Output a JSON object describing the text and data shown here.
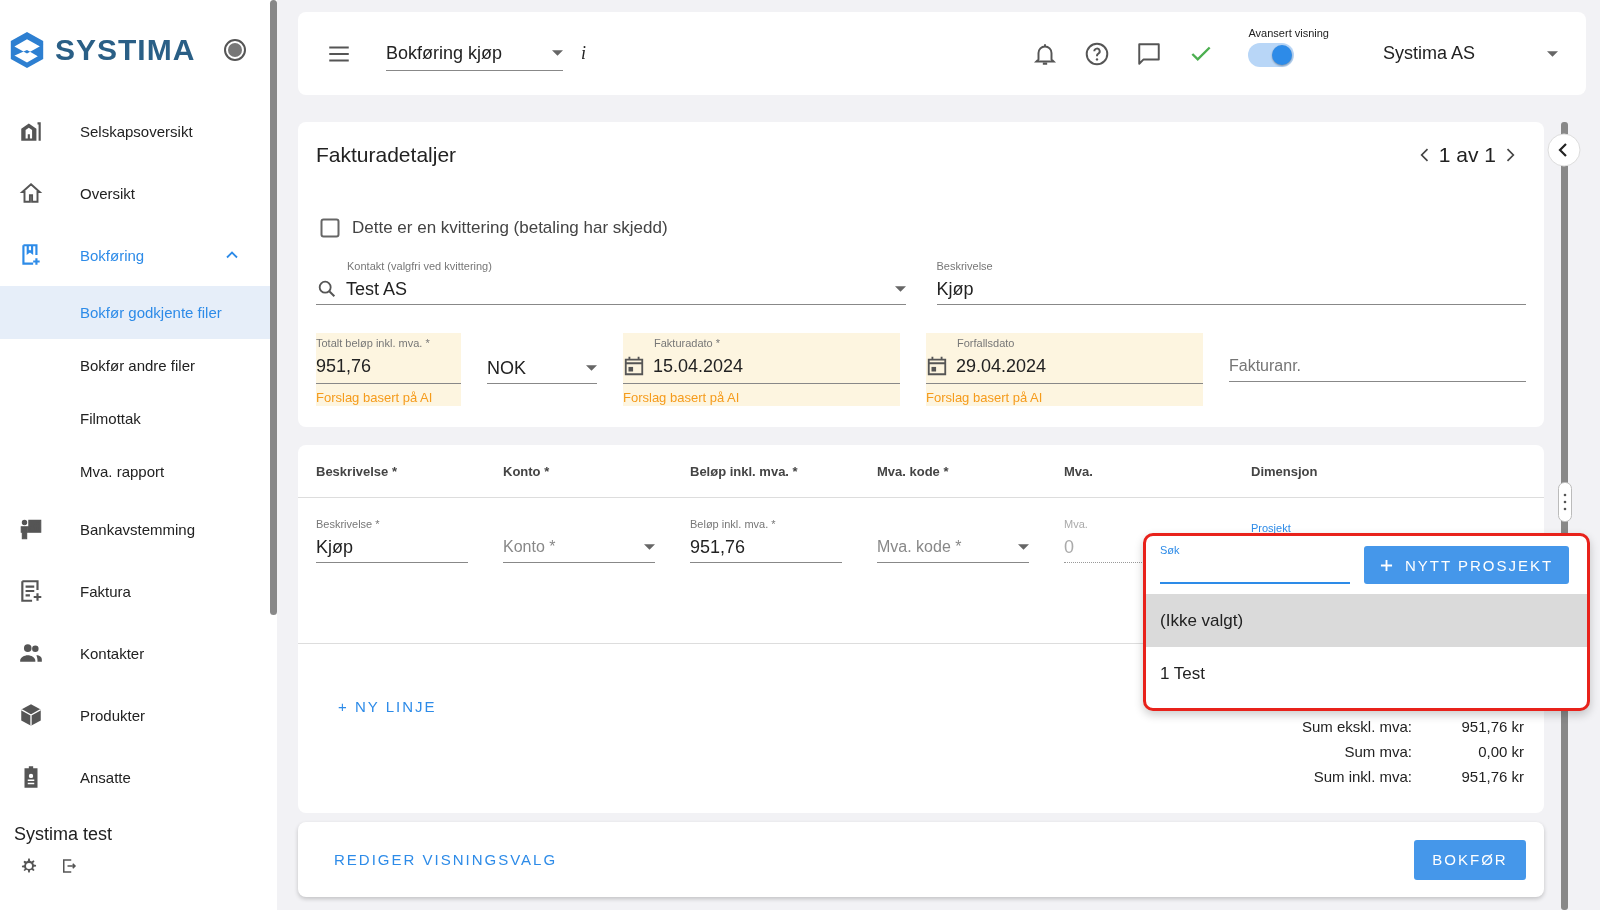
{
  "sidebar": {
    "logo": "SYSTIMA",
    "items": [
      {
        "label": "Selskapsoversikt",
        "selected": false
      },
      {
        "label": "Oversikt",
        "selected": false
      },
      {
        "label": "Bokføring",
        "selected": false,
        "expanded": true,
        "children": [
          {
            "label": "Bokfør godkjente filer",
            "selected": true
          },
          {
            "label": "Bokfør andre filer",
            "selected": false
          },
          {
            "label": "Filmottak",
            "selected": false
          },
          {
            "label": "Mva. rapport",
            "selected": false
          }
        ]
      },
      {
        "label": "Bankavstemming",
        "selected": false
      },
      {
        "label": "Faktura",
        "selected": false
      },
      {
        "label": "Kontakter",
        "selected": false
      },
      {
        "label": "Produkter",
        "selected": false
      },
      {
        "label": "Ansatte",
        "selected": false
      }
    ],
    "company": "Systima test"
  },
  "top_bar": {
    "view_select": "Bokføring kjøp",
    "info": "i",
    "advanced_view": {
      "label": "Avansert visning",
      "on": true
    },
    "company_select": "Systima AS"
  },
  "invoice_details": {
    "title": "Fakturadetaljer",
    "pager": "1 av 1",
    "receipt_checkbox": {
      "label": "Dette er en kvittering (betaling har skjedd)",
      "checked": false
    },
    "contact": {
      "label": "Kontakt (valgfri ved kvittering)",
      "value": "Test AS"
    },
    "description": {
      "label": "Beskrivelse",
      "value": "Kjøp"
    },
    "amount": {
      "label": "Totalt beløp inkl. mva. *",
      "value": "951,76",
      "ai_suggested": true,
      "hint": "Forslag basert på AI"
    },
    "currency": {
      "value": "NOK"
    },
    "invoice_date": {
      "label": "Fakturadato *",
      "value": "15.04.2024",
      "ai_suggested": true,
      "hint": "Forslag basert på AI"
    },
    "due_date": {
      "label": "Forfallsdato",
      "value": "29.04.2024",
      "ai_suggested": true,
      "hint": "Forslag basert på AI"
    },
    "invoice_number": {
      "placeholder": "Fakturanr."
    }
  },
  "lines": {
    "columns": [
      "Beskrivelse *",
      "Konto *",
      "Beløp inkl. mva. *",
      "Mva. kode *",
      "Mva.",
      "Dimensjon"
    ],
    "row": [
      {
        "kind": "text",
        "label": "Beskrivelse *",
        "value": "Kjøp"
      },
      {
        "kind": "select",
        "placeholder": "Konto *"
      },
      {
        "kind": "text",
        "label": "Beløp inkl. mva. *",
        "value": "951,76"
      },
      {
        "kind": "select",
        "placeholder": "Mva. kode *"
      },
      {
        "kind": "readonly",
        "label": "Mva.",
        "value": "0"
      },
      {
        "kind": "dimension",
        "label": "Prosjekt"
      }
    ],
    "new_line": "+ NY LINJE",
    "sums": [
      {
        "label": "Sum ekskl. mva:",
        "value": "951,76 kr"
      },
      {
        "label": "Sum mva:",
        "value": "0,00 kr"
      },
      {
        "label": "Sum inkl. mva:",
        "value": "951,76 kr"
      }
    ]
  },
  "project_dropdown": {
    "search_label": "Søk",
    "new_button": "NYTT PROSJEKT",
    "options": [
      {
        "label": "(Ikke valgt)",
        "selected": true
      },
      {
        "label": "1 Test",
        "selected": false
      }
    ]
  },
  "footer": {
    "edit_view": "REDIGER VISNINGSVALG",
    "post_button": "BOKFØR"
  }
}
